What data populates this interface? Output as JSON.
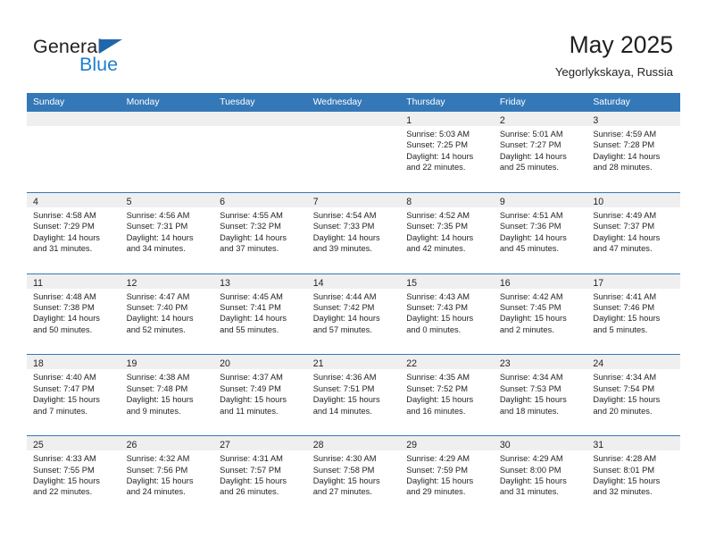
{
  "brand": {
    "name_top": "General",
    "name_bottom": "Blue",
    "triangle_color": "#1f67ad",
    "blue_color": "#1f7fd0"
  },
  "header": {
    "month_title": "May 2025",
    "location": "Yegorlykskaya, Russia"
  },
  "theme": {
    "header_bar_color": "#3478b8",
    "day_band_color": "#efefef",
    "text_color": "#231f20"
  },
  "weekdays": [
    "Sunday",
    "Monday",
    "Tuesday",
    "Wednesday",
    "Thursday",
    "Friday",
    "Saturday"
  ],
  "labels": {
    "sunrise_prefix": "Sunrise:",
    "sunset_prefix": "Sunset:",
    "daylight_prefix": "Daylight:"
  },
  "weeks": [
    [
      {
        "day": "",
        "sunrise": "",
        "sunset": "",
        "daylight_line1": "",
        "daylight_line2": "",
        "empty": true
      },
      {
        "day": "",
        "sunrise": "",
        "sunset": "",
        "daylight_line1": "",
        "daylight_line2": "",
        "empty": true
      },
      {
        "day": "",
        "sunrise": "",
        "sunset": "",
        "daylight_line1": "",
        "daylight_line2": "",
        "empty": true
      },
      {
        "day": "",
        "sunrise": "",
        "sunset": "",
        "daylight_line1": "",
        "daylight_line2": "",
        "empty": true
      },
      {
        "day": "1",
        "sunrise": "Sunrise: 5:03 AM",
        "sunset": "Sunset: 7:25 PM",
        "daylight_line1": "Daylight: 14 hours",
        "daylight_line2": "and 22 minutes.",
        "empty": false
      },
      {
        "day": "2",
        "sunrise": "Sunrise: 5:01 AM",
        "sunset": "Sunset: 7:27 PM",
        "daylight_line1": "Daylight: 14 hours",
        "daylight_line2": "and 25 minutes.",
        "empty": false
      },
      {
        "day": "3",
        "sunrise": "Sunrise: 4:59 AM",
        "sunset": "Sunset: 7:28 PM",
        "daylight_line1": "Daylight: 14 hours",
        "daylight_line2": "and 28 minutes.",
        "empty": false
      }
    ],
    [
      {
        "day": "4",
        "sunrise": "Sunrise: 4:58 AM",
        "sunset": "Sunset: 7:29 PM",
        "daylight_line1": "Daylight: 14 hours",
        "daylight_line2": "and 31 minutes.",
        "empty": false
      },
      {
        "day": "5",
        "sunrise": "Sunrise: 4:56 AM",
        "sunset": "Sunset: 7:31 PM",
        "daylight_line1": "Daylight: 14 hours",
        "daylight_line2": "and 34 minutes.",
        "empty": false
      },
      {
        "day": "6",
        "sunrise": "Sunrise: 4:55 AM",
        "sunset": "Sunset: 7:32 PM",
        "daylight_line1": "Daylight: 14 hours",
        "daylight_line2": "and 37 minutes.",
        "empty": false
      },
      {
        "day": "7",
        "sunrise": "Sunrise: 4:54 AM",
        "sunset": "Sunset: 7:33 PM",
        "daylight_line1": "Daylight: 14 hours",
        "daylight_line2": "and 39 minutes.",
        "empty": false
      },
      {
        "day": "8",
        "sunrise": "Sunrise: 4:52 AM",
        "sunset": "Sunset: 7:35 PM",
        "daylight_line1": "Daylight: 14 hours",
        "daylight_line2": "and 42 minutes.",
        "empty": false
      },
      {
        "day": "9",
        "sunrise": "Sunrise: 4:51 AM",
        "sunset": "Sunset: 7:36 PM",
        "daylight_line1": "Daylight: 14 hours",
        "daylight_line2": "and 45 minutes.",
        "empty": false
      },
      {
        "day": "10",
        "sunrise": "Sunrise: 4:49 AM",
        "sunset": "Sunset: 7:37 PM",
        "daylight_line1": "Daylight: 14 hours",
        "daylight_line2": "and 47 minutes.",
        "empty": false
      }
    ],
    [
      {
        "day": "11",
        "sunrise": "Sunrise: 4:48 AM",
        "sunset": "Sunset: 7:38 PM",
        "daylight_line1": "Daylight: 14 hours",
        "daylight_line2": "and 50 minutes.",
        "empty": false
      },
      {
        "day": "12",
        "sunrise": "Sunrise: 4:47 AM",
        "sunset": "Sunset: 7:40 PM",
        "daylight_line1": "Daylight: 14 hours",
        "daylight_line2": "and 52 minutes.",
        "empty": false
      },
      {
        "day": "13",
        "sunrise": "Sunrise: 4:45 AM",
        "sunset": "Sunset: 7:41 PM",
        "daylight_line1": "Daylight: 14 hours",
        "daylight_line2": "and 55 minutes.",
        "empty": false
      },
      {
        "day": "14",
        "sunrise": "Sunrise: 4:44 AM",
        "sunset": "Sunset: 7:42 PM",
        "daylight_line1": "Daylight: 14 hours",
        "daylight_line2": "and 57 minutes.",
        "empty": false
      },
      {
        "day": "15",
        "sunrise": "Sunrise: 4:43 AM",
        "sunset": "Sunset: 7:43 PM",
        "daylight_line1": "Daylight: 15 hours",
        "daylight_line2": "and 0 minutes.",
        "empty": false
      },
      {
        "day": "16",
        "sunrise": "Sunrise: 4:42 AM",
        "sunset": "Sunset: 7:45 PM",
        "daylight_line1": "Daylight: 15 hours",
        "daylight_line2": "and 2 minutes.",
        "empty": false
      },
      {
        "day": "17",
        "sunrise": "Sunrise: 4:41 AM",
        "sunset": "Sunset: 7:46 PM",
        "daylight_line1": "Daylight: 15 hours",
        "daylight_line2": "and 5 minutes.",
        "empty": false
      }
    ],
    [
      {
        "day": "18",
        "sunrise": "Sunrise: 4:40 AM",
        "sunset": "Sunset: 7:47 PM",
        "daylight_line1": "Daylight: 15 hours",
        "daylight_line2": "and 7 minutes.",
        "empty": false
      },
      {
        "day": "19",
        "sunrise": "Sunrise: 4:38 AM",
        "sunset": "Sunset: 7:48 PM",
        "daylight_line1": "Daylight: 15 hours",
        "daylight_line2": "and 9 minutes.",
        "empty": false
      },
      {
        "day": "20",
        "sunrise": "Sunrise: 4:37 AM",
        "sunset": "Sunset: 7:49 PM",
        "daylight_line1": "Daylight: 15 hours",
        "daylight_line2": "and 11 minutes.",
        "empty": false
      },
      {
        "day": "21",
        "sunrise": "Sunrise: 4:36 AM",
        "sunset": "Sunset: 7:51 PM",
        "daylight_line1": "Daylight: 15 hours",
        "daylight_line2": "and 14 minutes.",
        "empty": false
      },
      {
        "day": "22",
        "sunrise": "Sunrise: 4:35 AM",
        "sunset": "Sunset: 7:52 PM",
        "daylight_line1": "Daylight: 15 hours",
        "daylight_line2": "and 16 minutes.",
        "empty": false
      },
      {
        "day": "23",
        "sunrise": "Sunrise: 4:34 AM",
        "sunset": "Sunset: 7:53 PM",
        "daylight_line1": "Daylight: 15 hours",
        "daylight_line2": "and 18 minutes.",
        "empty": false
      },
      {
        "day": "24",
        "sunrise": "Sunrise: 4:34 AM",
        "sunset": "Sunset: 7:54 PM",
        "daylight_line1": "Daylight: 15 hours",
        "daylight_line2": "and 20 minutes.",
        "empty": false
      }
    ],
    [
      {
        "day": "25",
        "sunrise": "Sunrise: 4:33 AM",
        "sunset": "Sunset: 7:55 PM",
        "daylight_line1": "Daylight: 15 hours",
        "daylight_line2": "and 22 minutes.",
        "empty": false
      },
      {
        "day": "26",
        "sunrise": "Sunrise: 4:32 AM",
        "sunset": "Sunset: 7:56 PM",
        "daylight_line1": "Daylight: 15 hours",
        "daylight_line2": "and 24 minutes.",
        "empty": false
      },
      {
        "day": "27",
        "sunrise": "Sunrise: 4:31 AM",
        "sunset": "Sunset: 7:57 PM",
        "daylight_line1": "Daylight: 15 hours",
        "daylight_line2": "and 26 minutes.",
        "empty": false
      },
      {
        "day": "28",
        "sunrise": "Sunrise: 4:30 AM",
        "sunset": "Sunset: 7:58 PM",
        "daylight_line1": "Daylight: 15 hours",
        "daylight_line2": "and 27 minutes.",
        "empty": false
      },
      {
        "day": "29",
        "sunrise": "Sunrise: 4:29 AM",
        "sunset": "Sunset: 7:59 PM",
        "daylight_line1": "Daylight: 15 hours",
        "daylight_line2": "and 29 minutes.",
        "empty": false
      },
      {
        "day": "30",
        "sunrise": "Sunrise: 4:29 AM",
        "sunset": "Sunset: 8:00 PM",
        "daylight_line1": "Daylight: 15 hours",
        "daylight_line2": "and 31 minutes.",
        "empty": false
      },
      {
        "day": "31",
        "sunrise": "Sunrise: 4:28 AM",
        "sunset": "Sunset: 8:01 PM",
        "daylight_line1": "Daylight: 15 hours",
        "daylight_line2": "and 32 minutes.",
        "empty": false
      }
    ]
  ]
}
